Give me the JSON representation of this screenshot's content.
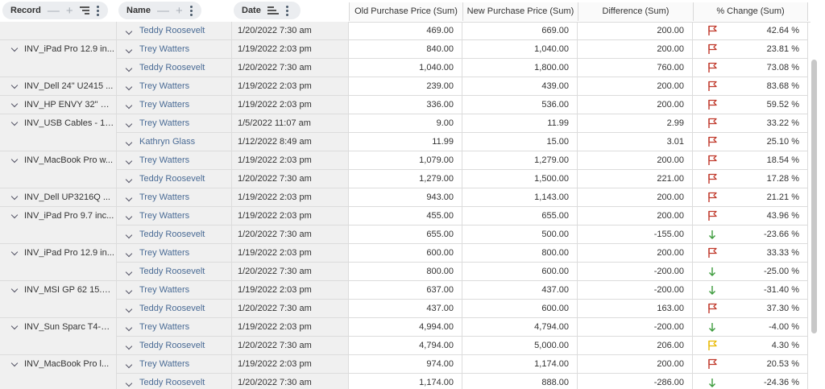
{
  "headers": {
    "record": "Record",
    "name": "Name",
    "date": "Date",
    "old_price": "Old Purchase Price (Sum)",
    "new_price": "New Purchase Price (Sum)",
    "difference": "Difference (Sum)",
    "pct_change": "% Change (Sum)"
  },
  "colors": {
    "flag_red": "#c0392b",
    "flag_yellow": "#e8b800",
    "arrow_green": "#3a9a3a",
    "name_link": "#4a6b95"
  },
  "rows": [
    {
      "record": "",
      "name": "Teddy Roosevelt",
      "date": "1/20/2022 7:30 am",
      "old": "469.00",
      "new": "669.00",
      "diff": "200.00",
      "pct": "42.64 %",
      "indicator": "red-flag"
    },
    {
      "record": "INV_iPad Pro 12.9 in...",
      "name": "Trey Watters",
      "date": "1/19/2022 2:03 pm",
      "old": "840.00",
      "new": "1,040.00",
      "diff": "200.00",
      "pct": "23.81 %",
      "indicator": "red-flag"
    },
    {
      "record": "",
      "name": "Teddy Roosevelt",
      "date": "1/20/2022 7:30 am",
      "old": "1,040.00",
      "new": "1,800.00",
      "diff": "760.00",
      "pct": "73.08 %",
      "indicator": "red-flag"
    },
    {
      "record": "INV_Dell 24\" U2415 ...",
      "name": "Trey Watters",
      "date": "1/19/2022 2:03 pm",
      "old": "239.00",
      "new": "439.00",
      "diff": "200.00",
      "pct": "83.68 %",
      "indicator": "red-flag"
    },
    {
      "record": "INV_HP ENVY 32\" M...",
      "name": "Trey Watters",
      "date": "1/19/2022 2:03 pm",
      "old": "336.00",
      "new": "536.00",
      "diff": "200.00",
      "pct": "59.52 %",
      "indicator": "red-flag"
    },
    {
      "record": "INV_USB Cables - 10...",
      "name": "Trey Watters",
      "date": "1/5/2022 11:07 am",
      "old": "9.00",
      "new": "11.99",
      "diff": "2.99",
      "pct": "33.22 %",
      "indicator": "red-flag"
    },
    {
      "record": "",
      "name": "Kathryn Glass",
      "date": "1/12/2022 8:49 am",
      "old": "11.99",
      "new": "15.00",
      "diff": "3.01",
      "pct": "25.10 %",
      "indicator": "red-flag"
    },
    {
      "record": "INV_MacBook Pro w...",
      "name": "Trey Watters",
      "date": "1/19/2022 2:03 pm",
      "old": "1,079.00",
      "new": "1,279.00",
      "diff": "200.00",
      "pct": "18.54 %",
      "indicator": "red-flag"
    },
    {
      "record": "",
      "name": "Teddy Roosevelt",
      "date": "1/20/2022 7:30 am",
      "old": "1,279.00",
      "new": "1,500.00",
      "diff": "221.00",
      "pct": "17.28 %",
      "indicator": "red-flag"
    },
    {
      "record": "INV_Dell UP3216Q ...",
      "name": "Trey Watters",
      "date": "1/19/2022 2:03 pm",
      "old": "943.00",
      "new": "1,143.00",
      "diff": "200.00",
      "pct": "21.21 %",
      "indicator": "red-flag"
    },
    {
      "record": "INV_iPad Pro 9.7 inc...",
      "name": "Trey Watters",
      "date": "1/19/2022 2:03 pm",
      "old": "455.00",
      "new": "655.00",
      "diff": "200.00",
      "pct": "43.96 %",
      "indicator": "red-flag"
    },
    {
      "record": "",
      "name": "Teddy Roosevelt",
      "date": "1/20/2022 7:30 am",
      "old": "655.00",
      "new": "500.00",
      "diff": "-155.00",
      "pct": "-23.66 %",
      "indicator": "green-arrow-down"
    },
    {
      "record": "INV_iPad Pro 12.9 in...",
      "name": "Trey Watters",
      "date": "1/19/2022 2:03 pm",
      "old": "600.00",
      "new": "800.00",
      "diff": "200.00",
      "pct": "33.33 %",
      "indicator": "red-flag"
    },
    {
      "record": "",
      "name": "Teddy Roosevelt",
      "date": "1/20/2022 7:30 am",
      "old": "800.00",
      "new": "600.00",
      "diff": "-200.00",
      "pct": "-25.00 %",
      "indicator": "green-arrow-down"
    },
    {
      "record": "INV_MSI GP 62 15.6 ...",
      "name": "Trey Watters",
      "date": "1/19/2022 2:03 pm",
      "old": "637.00",
      "new": "437.00",
      "diff": "-200.00",
      "pct": "-31.40 %",
      "indicator": "green-arrow-down"
    },
    {
      "record": "",
      "name": "Teddy Roosevelt",
      "date": "1/20/2022 7:30 am",
      "old": "437.00",
      "new": "600.00",
      "diff": "163.00",
      "pct": "37.30 %",
      "indicator": "red-flag"
    },
    {
      "record": "INV_Sun Sparc T4-2 ...",
      "name": "Trey Watters",
      "date": "1/19/2022 2:03 pm",
      "old": "4,994.00",
      "new": "4,794.00",
      "diff": "-200.00",
      "pct": "-4.00 %",
      "indicator": "green-arrow-down"
    },
    {
      "record": "",
      "name": "Teddy Roosevelt",
      "date": "1/20/2022 7:30 am",
      "old": "4,794.00",
      "new": "5,000.00",
      "diff": "206.00",
      "pct": "4.30 %",
      "indicator": "yellow-flag"
    },
    {
      "record": "INV_MacBook Pro l...",
      "name": "Trey Watters",
      "date": "1/19/2022 2:03 pm",
      "old": "974.00",
      "new": "1,174.00",
      "diff": "200.00",
      "pct": "20.53 %",
      "indicator": "red-flag"
    },
    {
      "record": "",
      "name": "Teddy Roosevelt",
      "date": "1/20/2022 7:30 am",
      "old": "1,174.00",
      "new": "888.00",
      "diff": "-286.00",
      "pct": "-24.36 %",
      "indicator": "green-arrow-down"
    }
  ]
}
